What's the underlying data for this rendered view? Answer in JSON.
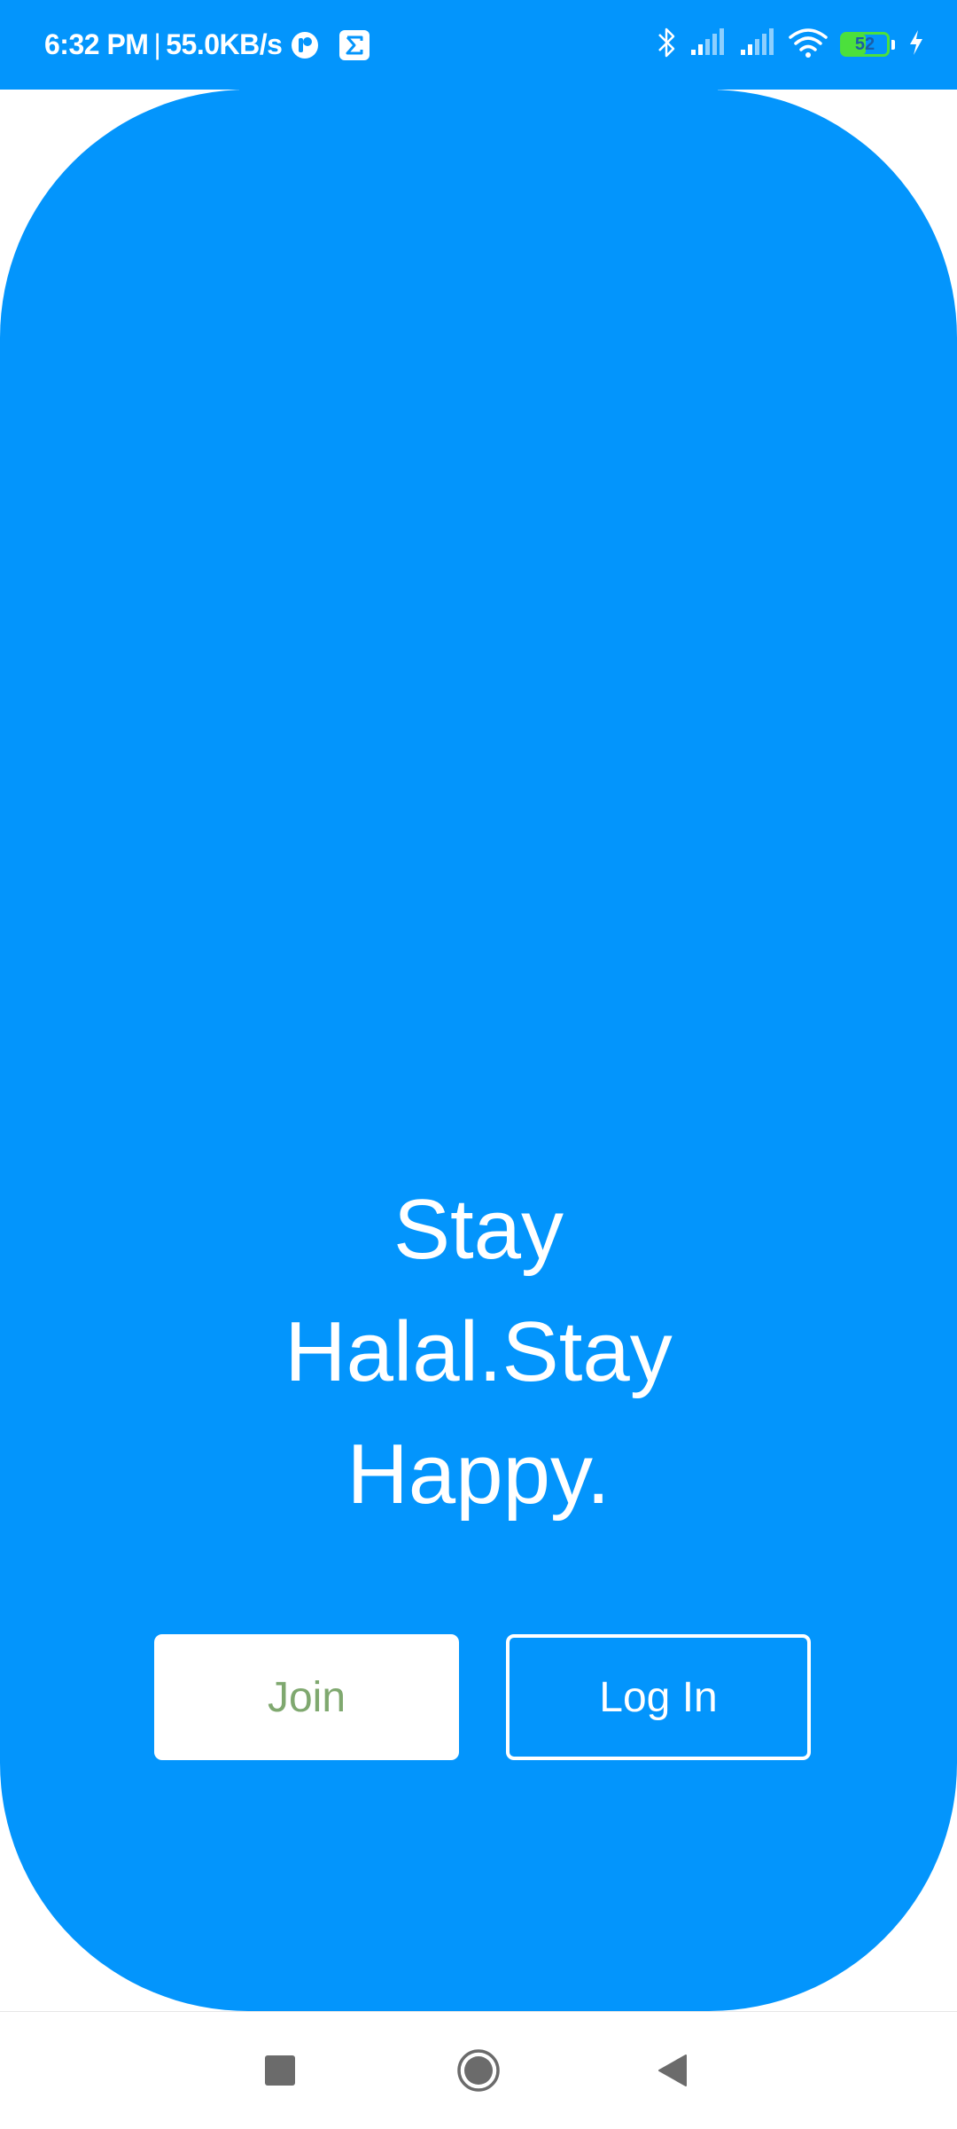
{
  "status_bar": {
    "time": "6:32 PM",
    "separator": "|",
    "network_speed": "55.0KB/s",
    "battery_level": "52",
    "battery_fraction": 0.52,
    "icons": [
      "app-notification-icon",
      "sigma-app-icon",
      "bluetooth-icon",
      "signal-icon",
      "signal-icon",
      "wifi-icon",
      "battery-icon",
      "charging-bolt-icon"
    ]
  },
  "hero": {
    "tagline_line1": "Stay",
    "tagline_line2": "Halal.Stay",
    "tagline_line3": "Happy."
  },
  "actions": {
    "join_label": "Join",
    "login_label": "Log In"
  },
  "nav": {
    "icons": [
      "recents-square-icon",
      "home-circle-icon",
      "back-triangle-icon"
    ]
  },
  "colors": {
    "brand_blue": "#0395fc",
    "join_text": "#7fa86f",
    "battery_green": "#4ce03c"
  }
}
